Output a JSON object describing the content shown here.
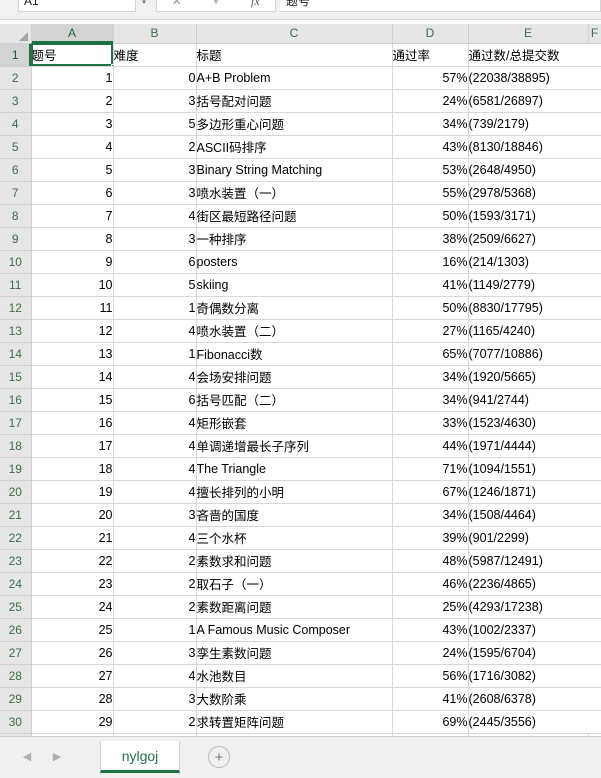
{
  "formula_bar": {
    "name_box_value": "A1",
    "name_box_dropdown": "▾",
    "cancel_label": "✕",
    "accept_label": "▾",
    "fx_label": "fx",
    "content_value": "题号"
  },
  "grid": {
    "corner_icon": "select-all-triangle",
    "columns": [
      "A",
      "B",
      "C",
      "D",
      "E",
      "F"
    ],
    "selected_column": "A",
    "selected_row": "1",
    "active_cell": "A1",
    "headers": {
      "A": "题号",
      "B": "难度",
      "C": "标题",
      "D": "通过率",
      "E": "通过数/总提交数"
    },
    "row_numbers": [
      "1",
      "2",
      "3",
      "4",
      "5",
      "6",
      "7",
      "8",
      "9",
      "10",
      "11",
      "12",
      "13",
      "14",
      "15",
      "16",
      "17",
      "18",
      "19",
      "20",
      "21",
      "22",
      "23",
      "24",
      "25",
      "26",
      "27",
      "28",
      "29",
      "30"
    ],
    "rows": [
      {
        "row": "2",
        "a": "1",
        "b": "0",
        "c": "A+B Problem",
        "d": "57%",
        "e": "(22038/38895)"
      },
      {
        "row": "3",
        "a": "2",
        "b": "3",
        "c": "括号配对问题",
        "d": "24%",
        "e": "(6581/26897)"
      },
      {
        "row": "4",
        "a": "3",
        "b": "5",
        "c": "多边形重心问题",
        "d": "34%",
        "e": "(739/2179)"
      },
      {
        "row": "5",
        "a": "4",
        "b": "2",
        "c": "ASCII码排序",
        "d": "43%",
        "e": "(8130/18846)"
      },
      {
        "row": "6",
        "a": "5",
        "b": "3",
        "c": "Binary String Matching",
        "d": "53%",
        "e": "(2648/4950)"
      },
      {
        "row": "7",
        "a": "6",
        "b": "3",
        "c": "喷水装置（一）",
        "d": "55%",
        "e": "(2978/5368)"
      },
      {
        "row": "8",
        "a": "7",
        "b": "4",
        "c": "街区最短路径问题",
        "d": "50%",
        "e": "(1593/3171)"
      },
      {
        "row": "9",
        "a": "8",
        "b": "3",
        "c": "一种排序",
        "d": "38%",
        "e": "(2509/6627)"
      },
      {
        "row": "10",
        "a": "9",
        "b": "6",
        "c": "posters",
        "d": "16%",
        "e": "(214/1303)"
      },
      {
        "row": "11",
        "a": "10",
        "b": "5",
        "c": "skiing",
        "d": "41%",
        "e": "(1149/2779)"
      },
      {
        "row": "12",
        "a": "11",
        "b": "1",
        "c": "奇偶数分离",
        "d": "50%",
        "e": "(8830/17795)"
      },
      {
        "row": "13",
        "a": "12",
        "b": "4",
        "c": "喷水装置（二）",
        "d": "27%",
        "e": "(1165/4240)"
      },
      {
        "row": "14",
        "a": "13",
        "b": "1",
        "c": "Fibonacci数",
        "d": "65%",
        "e": "(7077/10886)"
      },
      {
        "row": "15",
        "a": "14",
        "b": "4",
        "c": "会场安排问题",
        "d": "34%",
        "e": "(1920/5665)"
      },
      {
        "row": "16",
        "a": "15",
        "b": "6",
        "c": "括号匹配（二）",
        "d": "34%",
        "e": "(941/2744)"
      },
      {
        "row": "17",
        "a": "16",
        "b": "4",
        "c": "矩形嵌套",
        "d": "33%",
        "e": "(1523/4630)"
      },
      {
        "row": "18",
        "a": "17",
        "b": "4",
        "c": "单调递增最长子序列",
        "d": "44%",
        "e": "(1971/4444)"
      },
      {
        "row": "19",
        "a": "18",
        "b": "4",
        "c": "The Triangle",
        "d": "71%",
        "e": "(1094/1551)"
      },
      {
        "row": "20",
        "a": "19",
        "b": "4",
        "c": "擅长排列的小明",
        "d": "67%",
        "e": "(1246/1871)"
      },
      {
        "row": "21",
        "a": "20",
        "b": "3",
        "c": "吝啬的国度",
        "d": "34%",
        "e": "(1508/4464)"
      },
      {
        "row": "22",
        "a": "21",
        "b": "4",
        "c": "三个水杯",
        "d": "39%",
        "e": "(901/2299)"
      },
      {
        "row": "23",
        "a": "22",
        "b": "2",
        "c": "素数求和问题",
        "d": "48%",
        "e": "(5987/12491)"
      },
      {
        "row": "24",
        "a": "23",
        "b": "2",
        "c": "取石子（一）",
        "d": "46%",
        "e": "(2236/4865)"
      },
      {
        "row": "25",
        "a": "24",
        "b": "2",
        "c": "素数距离问题",
        "d": "25%",
        "e": "(4293/17238)"
      },
      {
        "row": "26",
        "a": "25",
        "b": "1",
        "c": "A Famous Music Composer",
        "d": "43%",
        "e": "(1002/2337)"
      },
      {
        "row": "27",
        "a": "26",
        "b": "3",
        "c": "孪生素数问题",
        "d": "24%",
        "e": "(1595/6704)"
      },
      {
        "row": "28",
        "a": "27",
        "b": "4",
        "c": "水池数目",
        "d": "56%",
        "e": "(1716/3082)"
      },
      {
        "row": "29",
        "a": "28",
        "b": "3",
        "c": "大数阶乘",
        "d": "41%",
        "e": "(2608/6378)"
      },
      {
        "row": "30",
        "a": "29",
        "b": "2",
        "c": "求转置矩阵问题",
        "d": "69%",
        "e": "(2445/3556)"
      }
    ]
  },
  "tabbar": {
    "prev_label": "◀",
    "next_label": "▶",
    "sheet_name": "nylgoj",
    "add_label": "+"
  },
  "colors": {
    "accent_green": "#217346",
    "header_gray": "#e6e6e6",
    "grid_line": "#d8d8d8"
  }
}
